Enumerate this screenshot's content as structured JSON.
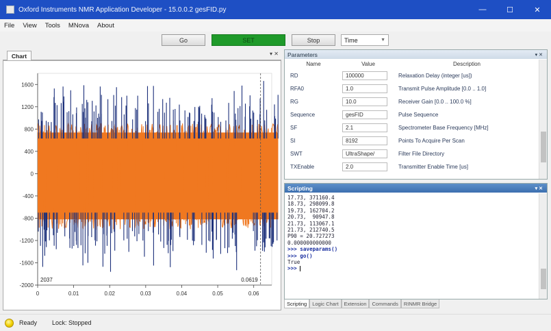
{
  "window": {
    "title": "Oxford Instruments NMR Application Developer - 15.0.0.2 gesFID.py",
    "controls": [
      "—",
      "☐",
      "✕"
    ]
  },
  "menu": [
    "File",
    "View",
    "Tools",
    "MNova",
    "About"
  ],
  "toolbar": {
    "go_label": "Go",
    "set_label": "SET",
    "stop_label": "Stop",
    "mode_select": "Time"
  },
  "chart_panel": {
    "tab_label": "Chart"
  },
  "chart_data": {
    "type": "line",
    "title": "",
    "xlabel": "",
    "ylabel": "",
    "xlim": [
      0,
      0.065
    ],
    "ylim": [
      -2000,
      1800
    ],
    "x_ticks": [
      "0",
      "0.01",
      "0.02",
      "0.03",
      "0.04",
      "0.05",
      "0.06"
    ],
    "y_ticks": [
      "1600",
      "1200",
      "800",
      "400",
      "0",
      "-400",
      "-800",
      "-1200",
      "-1600",
      "-2000"
    ],
    "series": [
      {
        "color": "#f07820",
        "description": "dense noise band",
        "envelope": [
          -1000,
          900
        ]
      },
      {
        "color": "#1b2f7a",
        "description": "noise spikes",
        "envelope": [
          -1850,
          1720
        ]
      }
    ],
    "cursor_x": 0.0619,
    "annotations": [
      "2037",
      "0.0619"
    ],
    "colors": {
      "primary": "#f07820",
      "secondary": "#1b2f7a",
      "cursor": "#555555"
    }
  },
  "parameters": {
    "title": "Parameters",
    "columns": [
      "Name",
      "Value",
      "Description"
    ],
    "rows": [
      {
        "name": "RD",
        "value": "100000",
        "desc": "Relaxation Delay (integer [us])"
      },
      {
        "name": "RFA0",
        "value": "1.0",
        "desc": "Transmit Pulse Amplitude [0.0 .. 1.0]"
      },
      {
        "name": "RG",
        "value": "10.0",
        "desc": "Receiver Gain [0.0 .. 100.0 %]"
      },
      {
        "name": "Sequence",
        "value": "gesFID",
        "desc": "Pulse Sequence"
      },
      {
        "name": "SF",
        "value": "2.1",
        "desc": "Spectrometer Base Frequency [MHz]"
      },
      {
        "name": "SI",
        "value": "8192",
        "desc": "Points To Acquire Per Scan"
      },
      {
        "name": "SWT",
        "value": "UltraShape/",
        "desc": "Filter File Directory"
      },
      {
        "name": "TXEnable",
        "value": "2.0",
        "desc": "Transmitter Enable Time [us]"
      }
    ]
  },
  "scripting": {
    "title": "Scripting",
    "lines": [
      {
        "text": "17.73, 371160.4",
        "prompt": false
      },
      {
        "text": "18.73, 298099.8",
        "prompt": false
      },
      {
        "text": "19.73, 162704.2",
        "prompt": false
      },
      {
        "text": "20.73,  90947.8",
        "prompt": false
      },
      {
        "text": "21.73, 113067.1",
        "prompt": false
      },
      {
        "text": "21.73, 212740.5",
        "prompt": false
      },
      {
        "text": "P90 = 20.727273",
        "prompt": false
      },
      {
        "text": "0.000000000000",
        "prompt": false
      },
      {
        "text": ">>> saveparams()",
        "prompt": true
      },
      {
        "text": ">>> go()",
        "prompt": true
      },
      {
        "text": "True",
        "prompt": false
      },
      {
        "text": ">>> ",
        "prompt": true
      }
    ]
  },
  "bottom_tabs": [
    "Scripting",
    "Logic Chart",
    "Extension",
    "Commands",
    "RINMR Bridge"
  ],
  "status": {
    "state": "Ready",
    "lock": "Lock: Stopped",
    "indicator_color": "#f0d000"
  }
}
